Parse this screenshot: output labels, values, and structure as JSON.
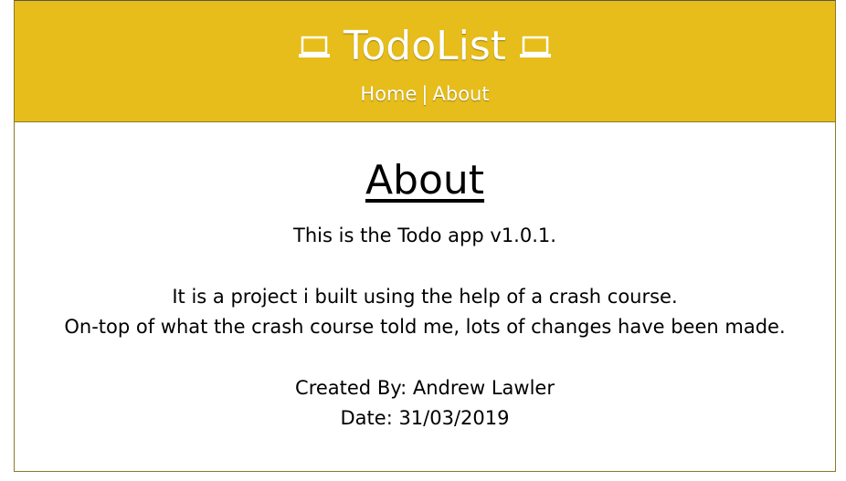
{
  "header": {
    "title": "TodoList",
    "left_icon": "laptop-icon",
    "right_icon": "laptop-icon",
    "nav": {
      "home_label": "Home",
      "separator": "|",
      "about_label": "About"
    }
  },
  "content": {
    "heading": "About",
    "version_line": "This is the Todo app v1.0.1.",
    "description_line_1": "It is a project i built using the help of a crash course.",
    "description_line_2": "On-top of what the crash course told me, lots of changes have been made.",
    "created_by": "Created By: Andrew Lawler",
    "date": "Date: 31/03/2019"
  },
  "colors": {
    "header_bg": "#e6bd1a",
    "header_text": "#ffffff",
    "border": "#8a7a28",
    "body_text": "#000000"
  }
}
